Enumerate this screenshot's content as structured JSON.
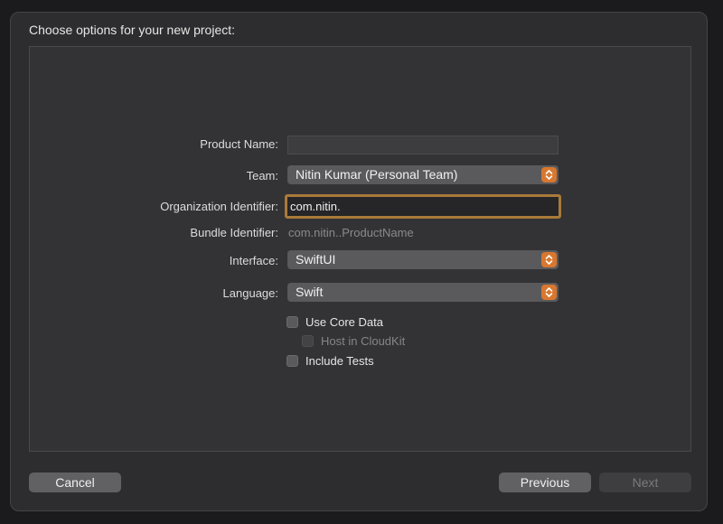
{
  "dialog": {
    "title": "Choose options for your new project:"
  },
  "form": {
    "product_name": {
      "label": "Product Name:",
      "value": ""
    },
    "team": {
      "label": "Team:",
      "value": "Nitin Kumar (Personal Team)"
    },
    "organization_identifier": {
      "label": "Organization Identifier:",
      "value": "com.nitin."
    },
    "bundle_identifier": {
      "label": "Bundle Identifier:",
      "value": "com.nitin..ProductName"
    },
    "interface": {
      "label": "Interface:",
      "value": "SwiftUI"
    },
    "language": {
      "label": "Language:",
      "value": "Swift"
    }
  },
  "options": {
    "use_core_data": {
      "label": "Use Core Data",
      "checked": false
    },
    "host_in_cloudkit": {
      "label": "Host in CloudKit",
      "checked": false,
      "enabled": false
    },
    "include_tests": {
      "label": "Include Tests",
      "checked": false
    }
  },
  "buttons": {
    "cancel": "Cancel",
    "previous": "Previous",
    "next": "Next"
  },
  "colors": {
    "accent": "#d8772f",
    "focus_ring": "#a97a3a"
  }
}
